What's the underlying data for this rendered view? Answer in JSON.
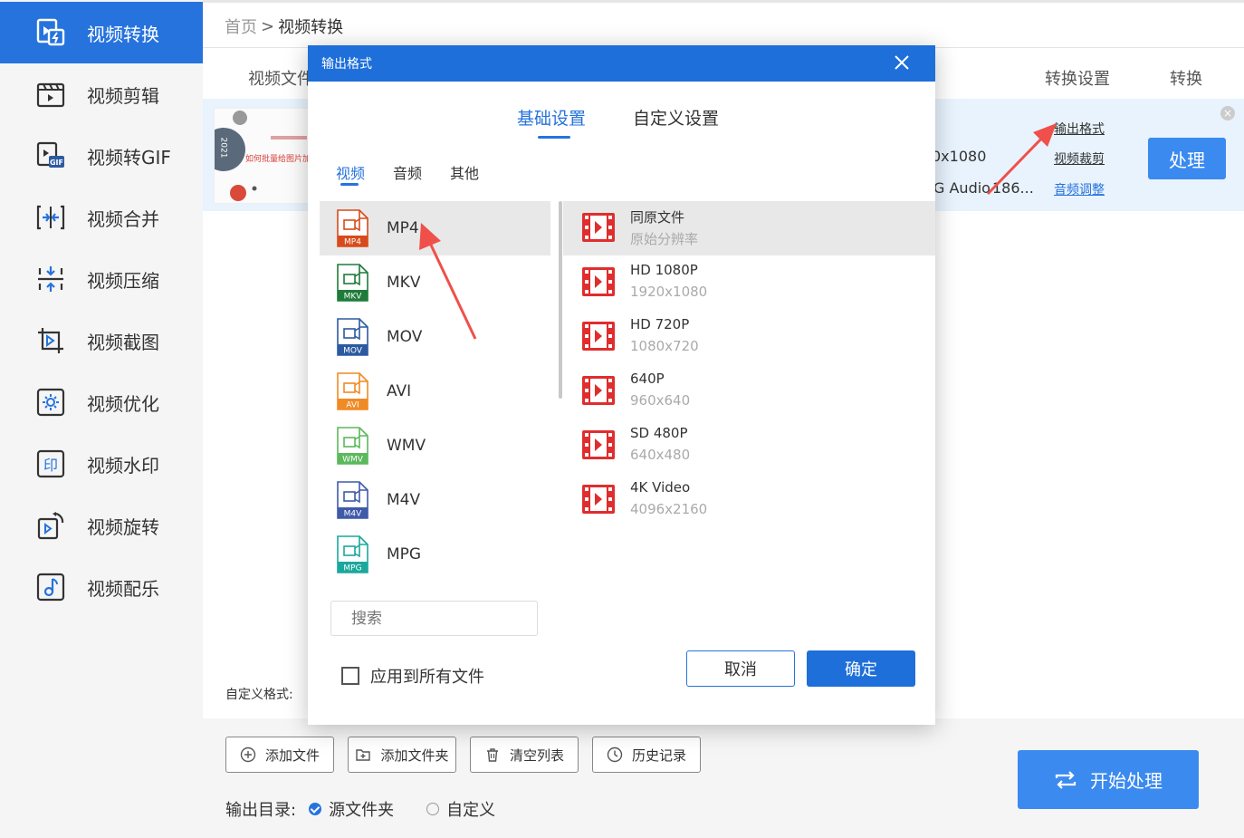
{
  "sidebar": {
    "items": [
      {
        "label": "视频转换",
        "icon": "video-convert-icon"
      },
      {
        "label": "视频剪辑",
        "icon": "video-edit-icon"
      },
      {
        "label": "视频转GIF",
        "icon": "video-gif-icon"
      },
      {
        "label": "视频合并",
        "icon": "video-merge-icon"
      },
      {
        "label": "视频压缩",
        "icon": "video-compress-icon"
      },
      {
        "label": "视频截图",
        "icon": "video-screenshot-icon"
      },
      {
        "label": "视频优化",
        "icon": "video-optimize-icon"
      },
      {
        "label": "视频水印",
        "icon": "video-watermark-icon"
      },
      {
        "label": "视频旋转",
        "icon": "video-rotate-icon"
      },
      {
        "label": "视频配乐",
        "icon": "video-music-icon"
      }
    ],
    "active_color": "#2673dd"
  },
  "breadcrumb": {
    "home": "首页",
    "separator": ">",
    "current": "视频转换"
  },
  "table": {
    "headers": {
      "file": "视频文件",
      "convert_settings": "转换设置",
      "convert": "转换"
    },
    "row": {
      "thumb_year": "2021",
      "thumb_title": "如何批量给图片加",
      "resolution": "0x1080",
      "audio": "G Audio",
      "bitrate": "186...",
      "link_output": "输出格式",
      "link_crop": "视频裁剪",
      "link_audio": "音频调整",
      "process_label": "处理"
    }
  },
  "custom_format_label": "自定义格式:",
  "bottom": {
    "add_file": "添加文件",
    "add_folder": "添加文件夹",
    "clear_list": "清空列表",
    "history": "历史记录",
    "output_dir_label": "输出目录:",
    "option_source": "源文件夹",
    "option_custom": "自定义",
    "start_label": "开始处理"
  },
  "dialog": {
    "title": "输出格式",
    "tabs": [
      "基础设置",
      "自定义设置"
    ],
    "subtabs": [
      "视频",
      "音频",
      "其他"
    ],
    "formats": [
      {
        "name": "MP4",
        "color": "#d84a1b"
      },
      {
        "name": "MKV",
        "color": "#1e7b3a"
      },
      {
        "name": "MOV",
        "color": "#2c5aa0"
      },
      {
        "name": "AVI",
        "color": "#f08a24"
      },
      {
        "name": "WMV",
        "color": "#5cb85c"
      },
      {
        "name": "M4V",
        "color": "#3f5aa8"
      },
      {
        "name": "MPG",
        "color": "#1aa89c"
      }
    ],
    "resolutions": [
      {
        "name": "同原文件",
        "sub": "原始分辨率"
      },
      {
        "name": "HD 1080P",
        "sub": "1920x1080"
      },
      {
        "name": "HD 720P",
        "sub": "1080x720"
      },
      {
        "name": "640P",
        "sub": "960x640"
      },
      {
        "name": "SD 480P",
        "sub": "640x480"
      },
      {
        "name": "4K Video",
        "sub": "4096x2160"
      }
    ],
    "search_placeholder": "搜索",
    "apply_all": "应用到所有文件",
    "cancel": "取消",
    "ok": "确定"
  }
}
